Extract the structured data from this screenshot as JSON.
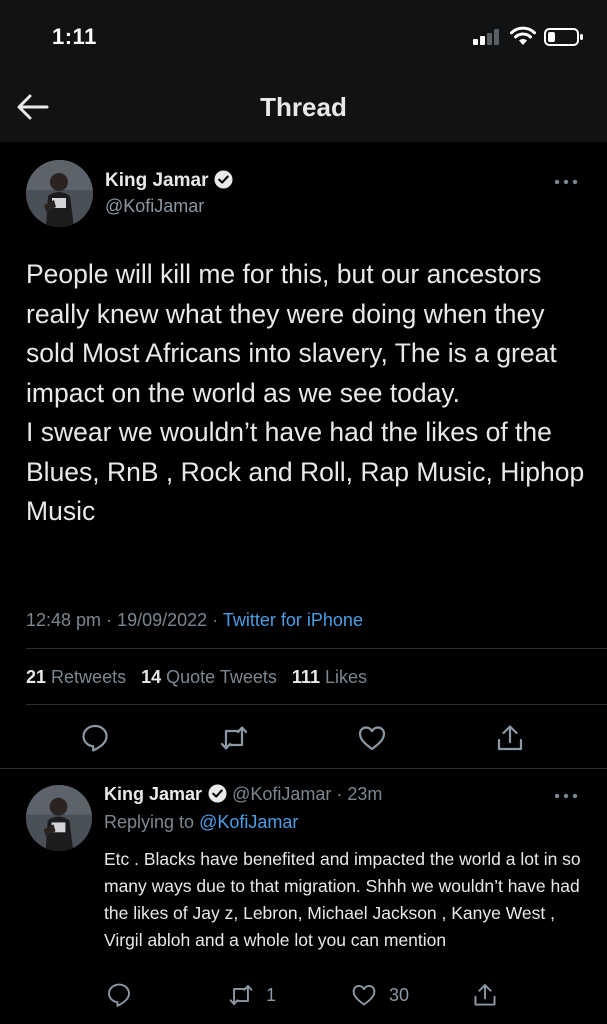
{
  "status_bar": {
    "time": "1:11",
    "icons": [
      "cellular-signal-icon",
      "wifi-icon",
      "battery-icon"
    ]
  },
  "header": {
    "title": "Thread",
    "back_icon": "back-arrow-icon"
  },
  "main_tweet": {
    "author_name": "King Jamar",
    "verified": true,
    "handle": "@KofiJamar",
    "text": "People will kill me for this, but our ancestors really knew what they were doing when they sold Most Africans into slavery, The is a great impact on the world as we see today.\nI swear we wouldn’t have had the likes of the Blues, RnB , Rock and Roll, Rap Music, Hiphop Music",
    "time": "12:48 pm",
    "date": "19/09/2022",
    "separator": "·",
    "client": "Twitter for iPhone",
    "stats": {
      "retweets_count": "21",
      "retweets_label": "Retweets",
      "quotes_count": "14",
      "quotes_label": "Quote Tweets",
      "likes_count": "111",
      "likes_label": "Likes"
    },
    "actions": [
      "reply-icon",
      "retweet-icon",
      "like-icon",
      "share-icon"
    ]
  },
  "reply_tweet": {
    "author_name": "King Jamar",
    "verified": true,
    "handle_time": "@KofiJamar · 23m",
    "replying_prefix": "Replying to",
    "replying_to": "@KofiJamar",
    "text": "Etc . Blacks have benefited and impacted the world a lot in so many ways due to that migration. Shhh we wouldn’t have had the likes of Jay z, Lebron, Michael Jackson , Kanye West , Virgil abloh and a whole lot you can mention",
    "retweet_count": "1",
    "like_count": "30"
  },
  "colors": {
    "background": "#000000",
    "bar_background": "#111214",
    "text": "#e7e9ea",
    "secondary_text": "#7a8791",
    "link": "#4b9ee6",
    "divider": "#2a2e33"
  }
}
